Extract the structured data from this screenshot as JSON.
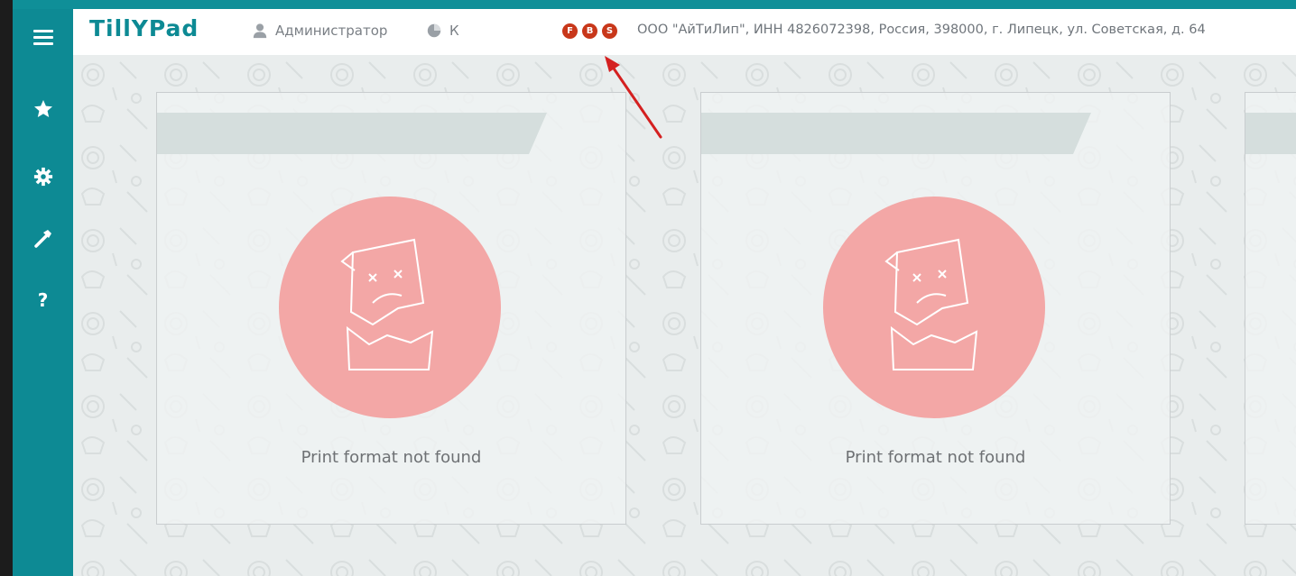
{
  "header": {
    "logo_text": "TillYPad",
    "user_name": "Администратор",
    "k_label": "К",
    "badges": [
      "F",
      "B",
      "S"
    ],
    "company_info": "ООО \"АйТиЛип\", ИНН 4826072398, Россия, 398000, г. Липецк, ул. Советская, д. 64"
  },
  "sidebar": {
    "items": [
      {
        "icon": "menu-icon"
      },
      {
        "icon": "star-icon"
      },
      {
        "icon": "gear-icon"
      },
      {
        "icon": "hammer-icon"
      },
      {
        "icon": "help-icon",
        "label": "?"
      }
    ]
  },
  "cards": [
    {
      "message": "Print format not found"
    },
    {
      "message": "Print format not found"
    }
  ],
  "colors": {
    "sidebar": "#0d8a94",
    "badge": "#c8371a",
    "error_circle": "#f3a7a6",
    "arrow": "#d42020"
  }
}
